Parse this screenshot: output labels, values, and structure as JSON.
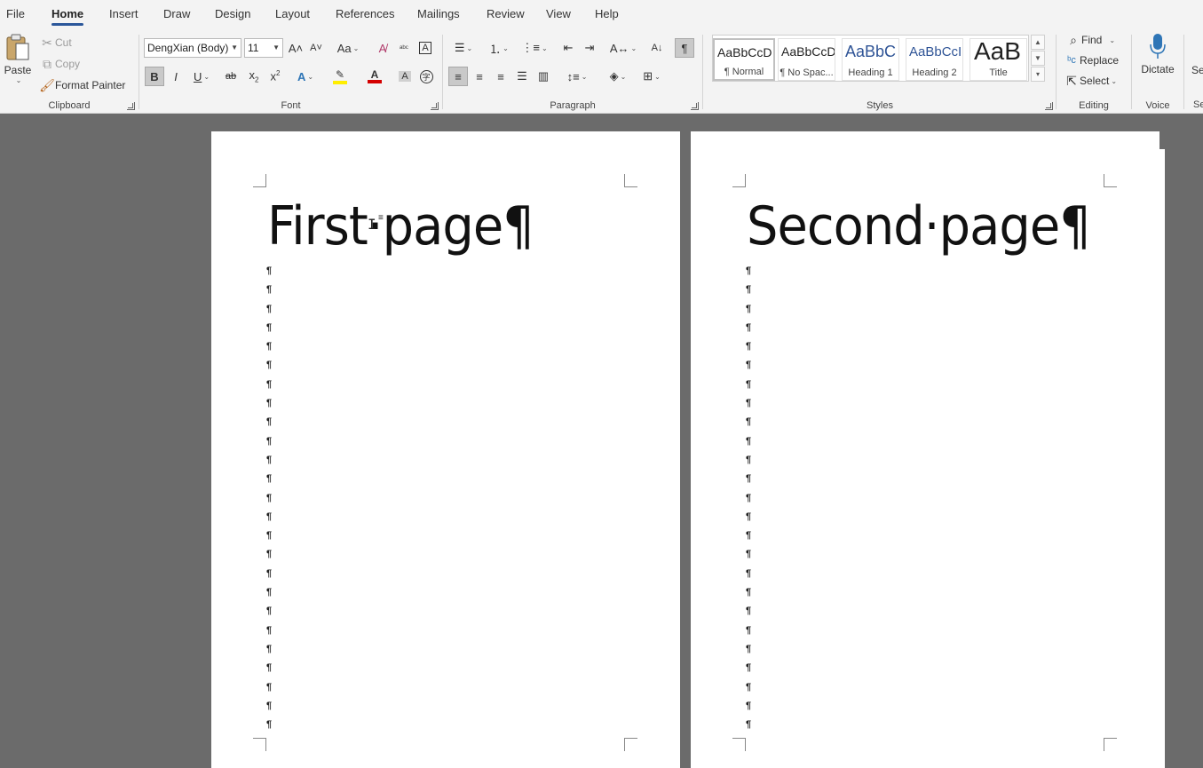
{
  "tabs": [
    "File",
    "Home",
    "Insert",
    "Draw",
    "Design",
    "Layout",
    "References",
    "Mailings",
    "Review",
    "View",
    "Help"
  ],
  "active_tab": "Home",
  "clipboard": {
    "label": "Clipboard",
    "paste": "Paste",
    "cut": "Cut",
    "copy": "Copy",
    "format_painter": "Format Painter"
  },
  "font": {
    "label": "Font",
    "family": "DengXian (Body)",
    "size": "11",
    "font_color": "#d40000",
    "highlight_color": "#ffee00"
  },
  "paragraph": {
    "label": "Paragraph"
  },
  "styles": {
    "label": "Styles",
    "items": [
      {
        "sample": "AaBbCcD",
        "name": "¶ Normal"
      },
      {
        "sample": "AaBbCcD",
        "name": "¶ No Spac..."
      },
      {
        "sample": "AaBbC",
        "name": "Heading 1"
      },
      {
        "sample": "AaBbCcI",
        "name": "Heading 2"
      },
      {
        "sample": "AaB",
        "name": "Title"
      }
    ]
  },
  "editing": {
    "label": "Editing",
    "find": "Find",
    "replace": "Replace",
    "select": "Select"
  },
  "voice": {
    "label": "Voice",
    "dictate": "Dictate"
  },
  "cut_off": {
    "button": "Se",
    "label": "Se"
  },
  "document": {
    "pages": [
      {
        "title": "First·page¶",
        "paragraph_marks": 25
      },
      {
        "title": "Second·page¶",
        "paragraph_marks": 25
      }
    ],
    "pilcrow": "¶"
  },
  "colors": {
    "accent": "#2b579a",
    "heading_blue": "#2f5496",
    "canvas": "#6b6b6b"
  }
}
